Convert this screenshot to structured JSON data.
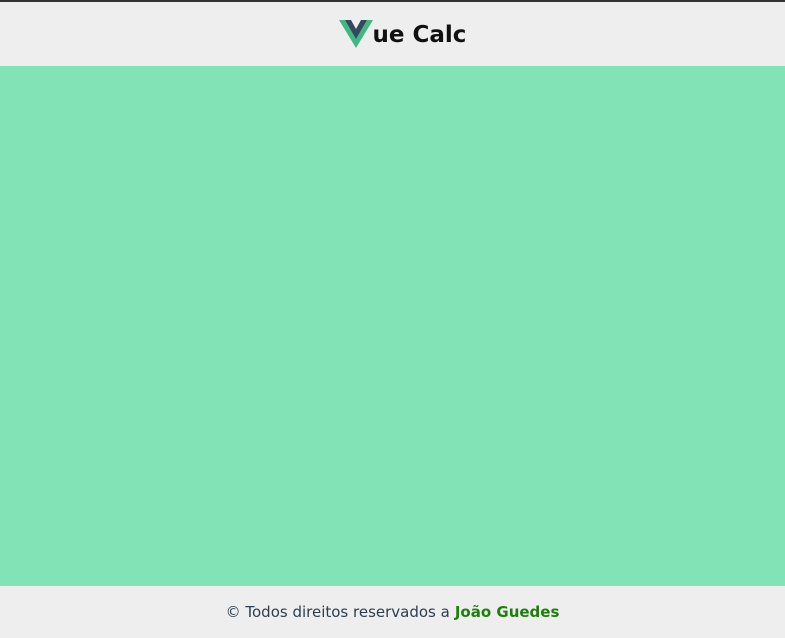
{
  "header": {
    "logo_icon": "vue-logo-icon",
    "title_rest": "ue Calc"
  },
  "colors": {
    "main_bg": "#82e3b6",
    "chrome_bg": "#eeeeee",
    "vue_green": "#41b883",
    "vue_dark": "#34495e",
    "author_link": "#1e7f0b"
  },
  "footer": {
    "text": "© Todos direitos reservados a",
    "author": "João Guedes"
  }
}
